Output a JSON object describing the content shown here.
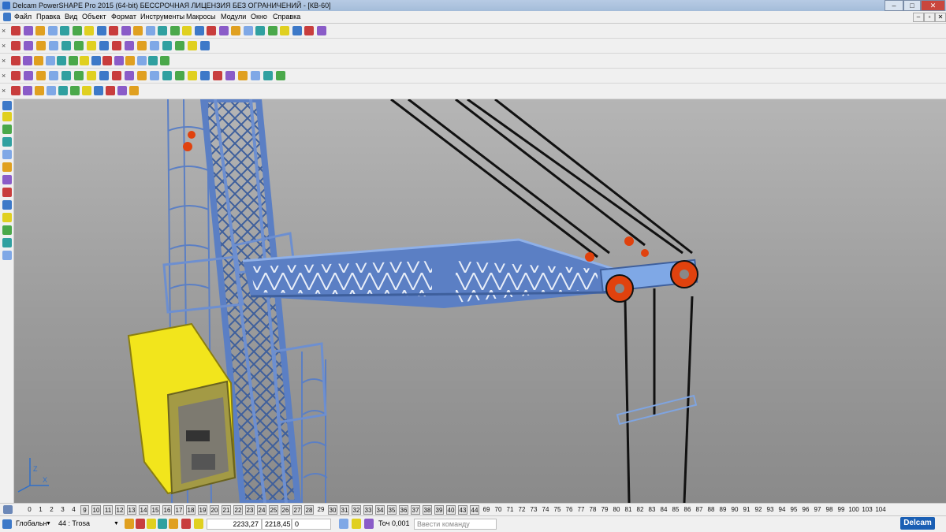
{
  "window": {
    "title": "Delcam PowerSHAPE Pro 2015 (64-bit) БЕССРОЧНАЯ ЛИЦЕНЗИЯ БЕЗ ОГРАНИЧЕНИЙ - [КВ-60]",
    "minimize": "–",
    "maximize": "□",
    "close": "✕"
  },
  "menu": {
    "items": [
      "Файл",
      "Правка",
      "Вид",
      "Объект",
      "Формат",
      "Инструменты",
      "Макросы",
      "Модули",
      "Окно",
      "Справка"
    ],
    "mdi": [
      "–",
      "▫",
      "✕"
    ]
  },
  "levels": {
    "items": [
      "0",
      "1",
      "2",
      "3",
      "4",
      "9",
      "10",
      "11",
      "12",
      "13",
      "14",
      "15",
      "16",
      "17",
      "18",
      "19",
      "20",
      "21",
      "22",
      "23",
      "24",
      "25",
      "26",
      "27",
      "28",
      "29",
      "30",
      "31",
      "32",
      "33",
      "34",
      "35",
      "36",
      "37",
      "38",
      "39",
      "40",
      "43",
      "44",
      "69",
      "70",
      "71",
      "72",
      "73",
      "74",
      "75",
      "76",
      "77",
      "78",
      "79",
      "80",
      "81",
      "82",
      "83",
      "84",
      "85",
      "86",
      "87",
      "88",
      "89",
      "90",
      "91",
      "92",
      "93",
      "94",
      "95",
      "96",
      "97",
      "98",
      "99",
      "100",
      "103",
      "104"
    ],
    "boxed": [
      "9",
      "10",
      "11",
      "12",
      "13",
      "14",
      "15",
      "16",
      "17",
      "18",
      "19",
      "20",
      "21",
      "22",
      "23",
      "24",
      "25",
      "26",
      "27",
      "28",
      "30",
      "31",
      "32",
      "33",
      "34",
      "35",
      "36",
      "37",
      "38",
      "39",
      "40",
      "43",
      "44"
    ]
  },
  "status": {
    "workplane": "Глобальн",
    "level": "44 : Trosa",
    "x": "2233,27",
    "y": "2218,45",
    "z": "0",
    "tol_label": "Точ",
    "tolerance": "0,001",
    "command_placeholder": "Ввести команду"
  },
  "brand": "Delcam",
  "axis": {
    "z": "Z",
    "x": "X"
  },
  "colors": {
    "structure": "#5b7fc4",
    "cabin": "#f2e51c",
    "sheave": "#e0420e",
    "background": "#a3a3a3"
  }
}
